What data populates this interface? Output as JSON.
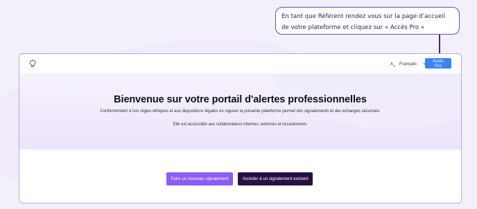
{
  "callout": {
    "line1": "En tant que Référent rendez vous sur la page d’accueil",
    "line2": "de votre plateforme et cliquez sur « Accès Pro »"
  },
  "header": {
    "logo_icon": "lightbulb-icon",
    "language": "Français",
    "language_icon": "translate-icon",
    "dropdown_icon": "chevron-down-icon",
    "pro_button_label": "Accès Pro"
  },
  "hero": {
    "title": "Bienvenue sur votre portail d'alertes professionnelles",
    "subtitle": "Conformément à nos règles éthiques et aux dispositions légales en vigueur la présente plateforme permet des signalements et des échanges sécurisés.",
    "access_text": "Elle est accessible aux collaborateurs internes, externes et occasionnels."
  },
  "actions": {
    "new_report_label": "Faire un nouveau signalement",
    "existing_report_label": "Accéder à un signalement existant"
  },
  "colors": {
    "accent_blue": "#3b82f6",
    "accent_purple": "#8b5cf6",
    "dark_purple": "#2a0f45",
    "callout_border": "#6b46c1"
  }
}
